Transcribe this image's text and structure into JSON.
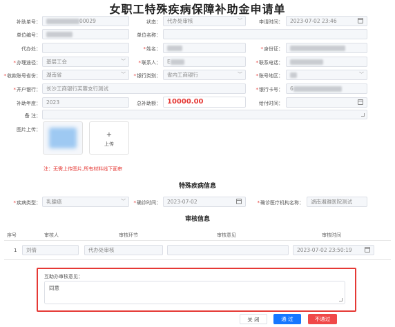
{
  "title": "女职工特殊疾病保障补助金申请单",
  "form": {
    "subsidy_no_label": "补助单号：",
    "subsidy_no_suffix": "00029",
    "status_label": "状态：",
    "status_value": "代办处审核",
    "apply_time_label": "申请时间：",
    "apply_time_value": "2023-07-02 23:46",
    "unit_no_label": "单位编号：",
    "unit_name_label": "单位名称：",
    "agent_label": "代办处：",
    "name_label": "姓名：",
    "id_label": "身份证：",
    "channel_label": "办理途径：",
    "channel_value": "基层工会",
    "contact_label": "联系人：",
    "contact_value": "E",
    "phone_label": "联系电话：",
    "province_label": "收款账号省份：",
    "province_value": "湖南省",
    "bank_type_label": "银行类别：",
    "bank_type_value": "省内工商银行",
    "region_label": "账号地区：",
    "branch_label": "开户银行：",
    "branch_value": "长沙工商银行芙蓉支行测试",
    "card_label": "银行卡号：",
    "card_prefix": "6",
    "year_label": "补助年度：",
    "year_value": "2023",
    "total_label": "总补助额：",
    "total_value": "10000.00",
    "pay_time_label": "给付时间：",
    "remark_label": "备  注：",
    "upload_label": "图片上传：",
    "upload_plus": "+",
    "upload_text": "上传",
    "warning": "注：无需上传图片,所有材料线下面审"
  },
  "disease": {
    "heading": "特殊疾病信息",
    "type_label": "疾病类型：",
    "type_value": "乳腺癌",
    "diag_time_label": "确诊时间：",
    "diag_time_value": "2023-07-02",
    "hospital_label": "确诊医疗机构名称：",
    "hospital_value": "湖南湘雅医院测试"
  },
  "audit": {
    "heading": "审核信息",
    "columns": [
      "序号",
      "审核人",
      "审核环节",
      "审核意见",
      "审核时间"
    ],
    "rows": [
      {
        "index": "1",
        "reviewer": "刘倩",
        "stage": "代办处审核",
        "opinion": "",
        "time": "2023-07-02 23:50:19"
      }
    ]
  },
  "assist": {
    "label": "互助办审核意见：",
    "value": "同意"
  },
  "buttons": {
    "close": "关 闭",
    "pass": "通 过",
    "reject": "不通过"
  },
  "colors": {
    "primary": "#1677ff",
    "danger": "#f04848",
    "required": "#e53935"
  }
}
